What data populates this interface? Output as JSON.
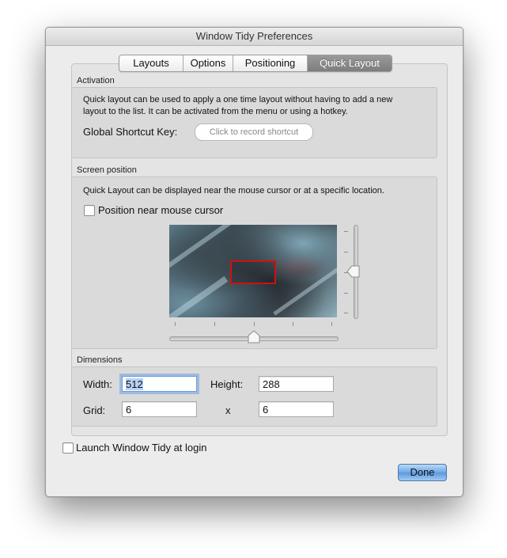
{
  "window": {
    "title": "Window Tidy Preferences"
  },
  "tabs": [
    {
      "label": "Layouts",
      "selected": false
    },
    {
      "label": "Options",
      "selected": false
    },
    {
      "label": "Positioning",
      "selected": false
    },
    {
      "label": "Quick Layout",
      "selected": true
    }
  ],
  "activation": {
    "heading": "Activation",
    "description_line1": "Quick layout can be used to apply a one time layout without having to add a new",
    "description_line2": "layout to the list. It can be activated from the menu or using a hotkey.",
    "shortcut_label": "Global Shortcut Key:",
    "shortcut_button": "Click to record shortcut"
  },
  "screen_position": {
    "heading": "Screen position",
    "description": "Quick Layout can be displayed near the mouse cursor or at a specific location.",
    "checkbox_label": "Position near mouse cursor",
    "checkbox_checked": false,
    "horizontal_slider_value": 0.5,
    "vertical_slider_value": 0.5,
    "selection_color": "#d01010"
  },
  "dimensions": {
    "heading": "Dimensions",
    "width_label": "Width:",
    "width_value": "512",
    "height_label": "Height:",
    "height_value": "288",
    "grid_label": "Grid:",
    "grid_x_value": "6",
    "times_symbol": "x",
    "grid_y_value": "6"
  },
  "launch_at_login": {
    "label": "Launch Window Tidy at login",
    "checked": false
  },
  "done_button": "Done",
  "colors": {
    "accent": "#6ea8e6",
    "selected_tab": "#8a8a8a"
  }
}
